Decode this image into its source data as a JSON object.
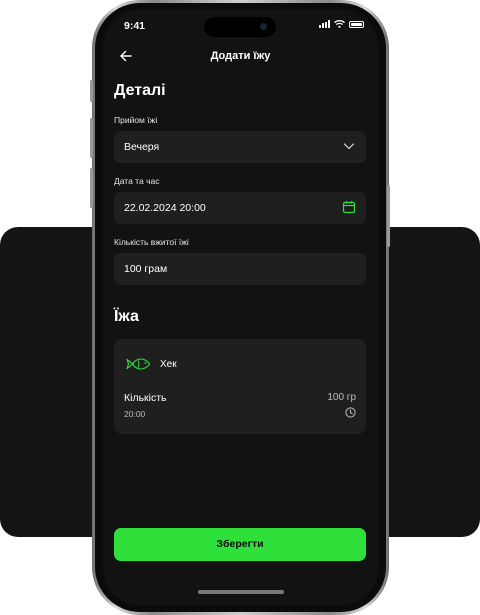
{
  "status_bar": {
    "time": "9:41"
  },
  "nav": {
    "title": "Додати їжу"
  },
  "details": {
    "title": "Деталі",
    "meal": {
      "label": "Прийом їжі",
      "value": "Вечеря"
    },
    "datetime": {
      "label": "Дата та час",
      "value": "22.02.2024 20:00"
    },
    "amount": {
      "label": "Кількість вжитої їжі",
      "value": "100 грам"
    }
  },
  "food": {
    "title": "Їжа",
    "item": {
      "name": "Хек",
      "icon": "fish-icon",
      "quantity_label": "Кількість",
      "quantity_value": "100 гр",
      "time": "20:00"
    }
  },
  "save_label": "Зберегти",
  "colors": {
    "accent": "#2fe03a",
    "screen_bg": "#121212",
    "field_bg": "#1f1f1f"
  }
}
